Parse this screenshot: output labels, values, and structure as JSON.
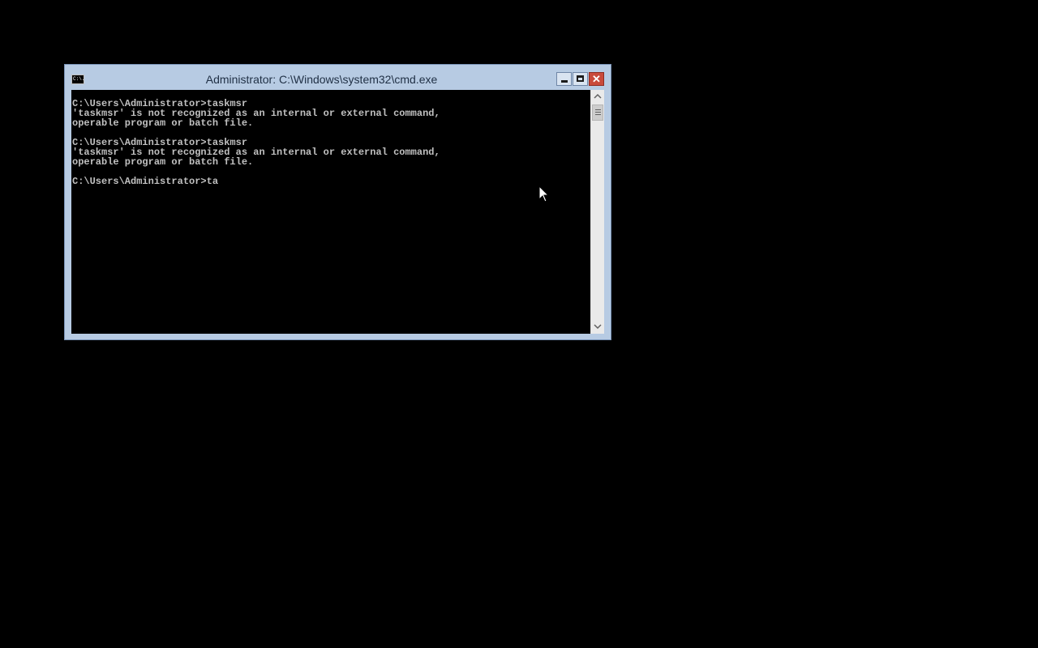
{
  "desktop": {
    "background_color": "#000000"
  },
  "window": {
    "title": "Administrator: C:\\Windows\\system32\\cmd.exe",
    "icon": "cmd-icon",
    "icon_text": "C:\\.",
    "controls": {
      "minimize_icon": "minimize-icon",
      "maximize_icon": "maximize-icon",
      "close_icon": "close-icon",
      "close_glyph": "✕"
    },
    "frame_color": "#b7cbe3",
    "close_color": "#c94a3b"
  },
  "console": {
    "background_color": "#000000",
    "text_color": "#c0c0c0",
    "lines": [
      "C:\\Users\\Administrator>taskmsr",
      "'taskmsr' is not recognized as an internal or external command,",
      "operable program or batch file.",
      "",
      "C:\\Users\\Administrator>taskmsr",
      "'taskmsr' is not recognized as an internal or external command,",
      "operable program or batch file.",
      "",
      "C:\\Users\\Administrator>ta"
    ]
  },
  "scrollbar": {
    "up_arrow": "^",
    "down_arrow": "v",
    "up_icon": "scroll-up-icon",
    "down_icon": "scroll-down-icon"
  },
  "pointer": {
    "icon": "mouse-pointer-icon"
  }
}
